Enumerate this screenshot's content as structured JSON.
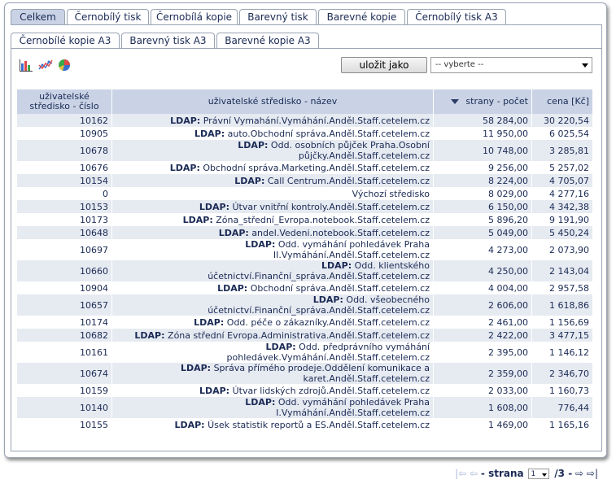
{
  "tabs_row1": [
    "Celkem",
    "Černobílý tisk",
    "Černobílá kopie",
    "Barevný tisk",
    "Barevné kopie",
    "Černobílý tisk A3"
  ],
  "tabs_row2": [
    "Černobílé kopie A3",
    "Barevný tisk A3",
    "Barevné kopie A3"
  ],
  "active_tab": "Celkem",
  "toolbar": {
    "icons": [
      "bar-chart-icon",
      "line-chart-icon",
      "pie-chart-icon"
    ],
    "save_label": "uložit jako",
    "select_value": "-- vyberte --"
  },
  "table": {
    "columns": [
      "uživatelské středisko - číslo",
      "uživatelské středisko - název",
      "strany - počet",
      "cena [Kč]"
    ],
    "sorted_column": "strany - počet",
    "rows": [
      {
        "id": "10162",
        "prefix": "LDAP:",
        "name": "Právní Vymahání.Vymáhání.Anděl.Staff.cetelem.cz",
        "pages": "58 284,00",
        "price": "30 220,54"
      },
      {
        "id": "10905",
        "prefix": "LDAP:",
        "name": "auto.Obchodní správa.Anděl.Staff.cetelem.cz",
        "pages": "11 950,00",
        "price": "6 025,54"
      },
      {
        "id": "10678",
        "prefix": "LDAP:",
        "name": "Odd. osobních půjček Praha.Osobní půjčky.Anděl.Staff.cetelem.cz",
        "pages": "10 748,00",
        "price": "3 285,81"
      },
      {
        "id": "10676",
        "prefix": "LDAP:",
        "name": "Obchodní správa.Marketing.Anděl.Staff.cetelem.cz",
        "pages": "9 256,00",
        "price": "5 257,02"
      },
      {
        "id": "10154",
        "prefix": "LDAP:",
        "name": "Call Centrum.Anděl.Staff.cetelem.cz",
        "pages": "8 224,00",
        "price": "4 705,07"
      },
      {
        "id": "0",
        "prefix": "",
        "name": "Výchozí středisko",
        "pages": "8 029,00",
        "price": "4 277,16"
      },
      {
        "id": "10153",
        "prefix": "LDAP:",
        "name": "Útvar vnitřní kontroly.Anděl.Staff.cetelem.cz",
        "pages": "6 150,00",
        "price": "4 342,38"
      },
      {
        "id": "10173",
        "prefix": "LDAP:",
        "name": "Zóna_střední_Evropa.notebook.Staff.cetelem.cz",
        "pages": "5 896,20",
        "price": "9 191,90"
      },
      {
        "id": "10648",
        "prefix": "LDAP:",
        "name": "andel.Vedeni.notebook.Staff.cetelem.cz",
        "pages": "5 049,00",
        "price": "5 450,24"
      },
      {
        "id": "10697",
        "prefix": "LDAP:",
        "name": "Odd. vymáhání pohledávek Praha II.Vymáhání.Anděl.Staff.cetelem.cz",
        "pages": "4 273,00",
        "price": "2 073,90"
      },
      {
        "id": "10660",
        "prefix": "LDAP:",
        "name": "Odd. klientského účetnictví.Finanční_správa.Anděl.Staff.cetelem.cz",
        "pages": "4 250,00",
        "price": "2 143,04"
      },
      {
        "id": "10904",
        "prefix": "LDAP:",
        "name": "Obchodní správa.Anděl.Staff.cetelem.cz",
        "pages": "4 004,00",
        "price": "2 957,58"
      },
      {
        "id": "10657",
        "prefix": "LDAP:",
        "name": "Odd. všeobecného účetnictví.Finanční_správa.Anděl.Staff.cetelem.cz",
        "pages": "2 606,00",
        "price": "1 618,86"
      },
      {
        "id": "10174",
        "prefix": "LDAP:",
        "name": "Odd. péče o zákazníky.Anděl.Staff.cetelem.cz",
        "pages": "2 461,00",
        "price": "1 156,69"
      },
      {
        "id": "10682",
        "prefix": "LDAP:",
        "name": "Zóna střední Evropa.Administrativa.Anděl.Staff.cetelem.cz",
        "pages": "2 422,00",
        "price": "3 477,15"
      },
      {
        "id": "10161",
        "prefix": "LDAP:",
        "name": "Odd. předprávního vymáhání pohledávek.Vymáhání.Anděl.Staff.cetelem.cz",
        "pages": "2 395,00",
        "price": "1 146,12"
      },
      {
        "id": "10674",
        "prefix": "LDAP:",
        "name": "Správa přímého prodeje.Oddělení komunikace a karet.Anděl.Staff.cetelem.cz",
        "pages": "2 359,00",
        "price": "2 346,70"
      },
      {
        "id": "10159",
        "prefix": "LDAP:",
        "name": "Útvar lidských zdrojů.Anděl.Staff.cetelem.cz",
        "pages": "2 033,00",
        "price": "1 160,73"
      },
      {
        "id": "10140",
        "prefix": "LDAP:",
        "name": "Odd. vymáhání pohledávek Praha I.Vymáhání.Anděl.Staff.cetelem.cz",
        "pages": "1 608,00",
        "price": "776,44"
      },
      {
        "id": "10155",
        "prefix": "LDAP:",
        "name": "Úsek statistik reportů a ES.Anděl.Staff.cetelem.cz",
        "pages": "1 469,00",
        "price": "1 165,16"
      }
    ]
  },
  "pager": {
    "label": "- strana",
    "current": "1",
    "total": "/3 -"
  },
  "colors": {
    "header_bg": "#c9d3e5",
    "row_alt_bg": "#e6eaf1",
    "text": "#1a2a55"
  }
}
